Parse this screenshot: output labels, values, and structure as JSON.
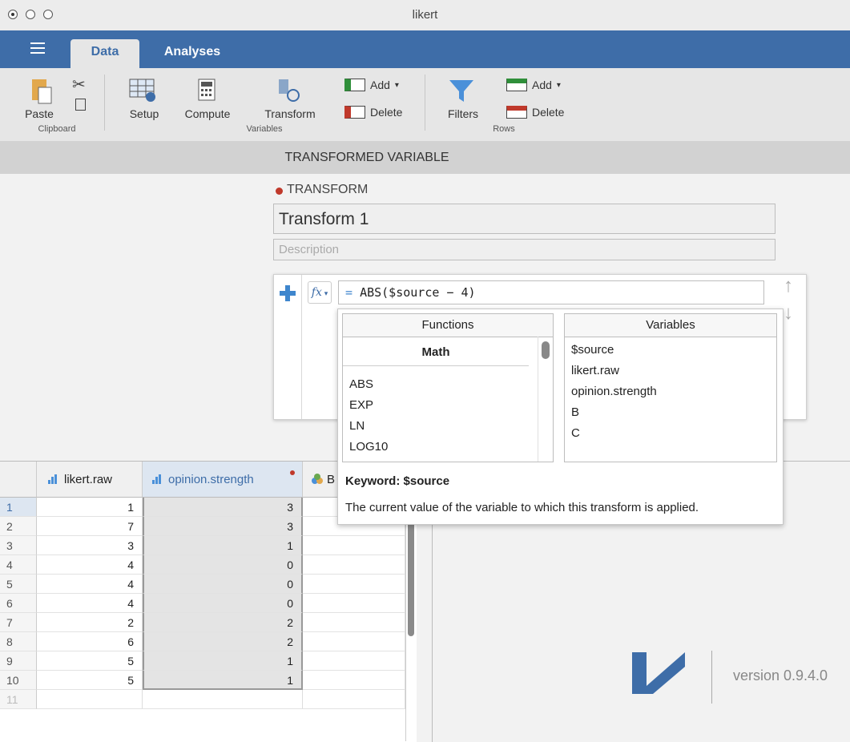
{
  "window": {
    "title": "likert"
  },
  "menubar": {
    "tabs": [
      "Data",
      "Analyses"
    ],
    "active_tab": "Data"
  },
  "ribbon": {
    "clipboard": {
      "paste": "Paste",
      "group": "Clipboard"
    },
    "variables": {
      "setup": "Setup",
      "compute": "Compute",
      "transform": "Transform",
      "add": "Add",
      "delete": "Delete",
      "group": "Variables"
    },
    "rows": {
      "filters": "Filters",
      "add": "Add",
      "delete": "Delete",
      "group": "Rows"
    }
  },
  "section": {
    "title": "TRANSFORMED VARIABLE"
  },
  "transform": {
    "label": "TRANSFORM",
    "name": "Transform 1",
    "description_placeholder": "Description",
    "formula_eq": "=",
    "formula": "ABS($source − 4)",
    "fx": "fx"
  },
  "dropdown": {
    "functions_header": "Functions",
    "variables_header": "Variables",
    "math_header": "Math",
    "functions": [
      "ABS",
      "EXP",
      "LN",
      "LOG10"
    ],
    "variables": [
      "$source",
      "likert.raw",
      "opinion.strength",
      "B",
      "C"
    ],
    "keyword_label": "Keyword: $source",
    "keyword_desc": "The current value of the variable to which this transform is applied."
  },
  "grid": {
    "columns": [
      "likert.raw",
      "opinion.strength",
      "B"
    ],
    "row_numbers": [
      "1",
      "2",
      "3",
      "4",
      "5",
      "6",
      "7",
      "8",
      "9",
      "10",
      "11"
    ],
    "likert_raw": [
      "1",
      "7",
      "3",
      "4",
      "4",
      "4",
      "2",
      "6",
      "5",
      "5"
    ],
    "opinion_strength": [
      "3",
      "3",
      "1",
      "0",
      "0",
      "0",
      "2",
      "2",
      "1",
      "1"
    ]
  },
  "footer": {
    "version": "version 0.9.4.0"
  },
  "colors": {
    "brand": "#3e6da8",
    "transform_dot": "#c0392b"
  }
}
